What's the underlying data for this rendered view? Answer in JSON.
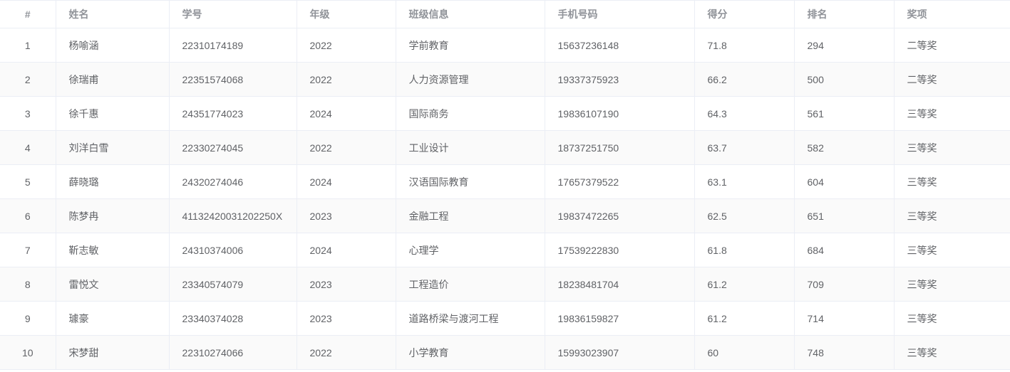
{
  "table": {
    "headers": [
      "#",
      "姓名",
      "学号",
      "年级",
      "班级信息",
      "手机号码",
      "得分",
      "排名",
      "奖项"
    ],
    "rows": [
      [
        "1",
        "杨喻涵",
        "22310174189",
        "2022",
        "学前教育",
        "15637236148",
        "71.8",
        "294",
        "二等奖"
      ],
      [
        "2",
        "徐瑞甫",
        "22351574068",
        "2022",
        "人力资源管理",
        "19337375923",
        "66.2",
        "500",
        "二等奖"
      ],
      [
        "3",
        "徐千惠",
        "24351774023",
        "2024",
        "国际商务",
        "19836107190",
        "64.3",
        "561",
        "三等奖"
      ],
      [
        "4",
        "刘洋白雪",
        "22330274045",
        "2022",
        "工业设计",
        "18737251750",
        "63.7",
        "582",
        "三等奖"
      ],
      [
        "5",
        "薛晓璐",
        "24320274046",
        "2024",
        "汉语国际教育",
        "17657379522",
        "63.1",
        "604",
        "三等奖"
      ],
      [
        "6",
        "陈梦冉",
        "41132420031202250X",
        "2023",
        "金融工程",
        "19837472265",
        "62.5",
        "651",
        "三等奖"
      ],
      [
        "7",
        "靳志敏",
        "24310374006",
        "2024",
        "心理学",
        "17539222830",
        "61.8",
        "684",
        "三等奖"
      ],
      [
        "8",
        "雷悦文",
        "23340574079",
        "2023",
        "工程造价",
        "18238481704",
        "61.2",
        "709",
        "三等奖"
      ],
      [
        "9",
        "璩豪",
        "23340374028",
        "2023",
        "道路桥梁与渡河工程",
        "19836159827",
        "61.2",
        "714",
        "三等奖"
      ],
      [
        "10",
        "宋梦甜",
        "22310274066",
        "2022",
        "小学教育",
        "15993023907",
        "60",
        "748",
        "三等奖"
      ]
    ]
  }
}
